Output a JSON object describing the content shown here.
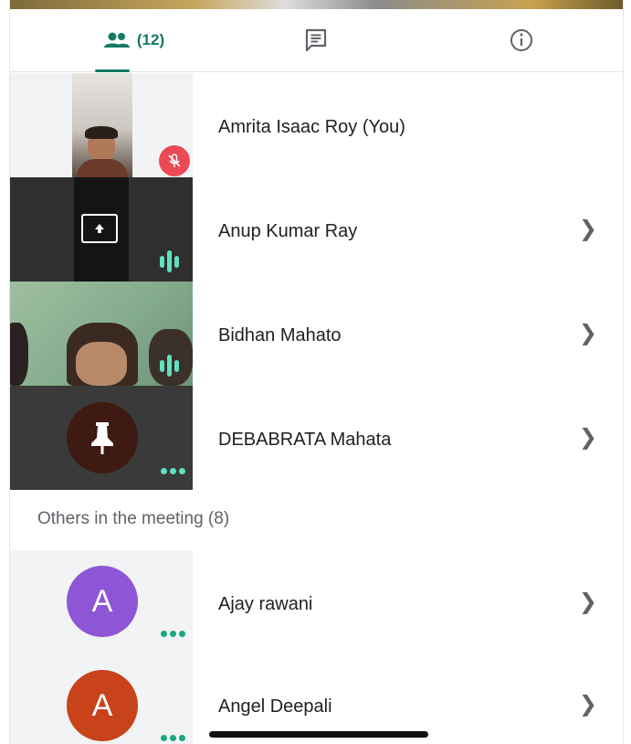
{
  "tabs": {
    "people_count": "(12)",
    "accent_color": "#137a65",
    "people_icon": "people-icon",
    "chat_icon": "chat-icon",
    "info_icon": "info-icon"
  },
  "participants": [
    {
      "name": "Amrita Isaac Roy (You)",
      "status": "mic-off"
    },
    {
      "name": "Anup Kumar Ray",
      "status": "speaking"
    },
    {
      "name": "Bidhan Mahato",
      "status": "speaking"
    },
    {
      "name": "DEBABRATA Mahata",
      "status": "more"
    }
  ],
  "others_section": {
    "title": "Others in the meeting (8)",
    "people": [
      {
        "name": "Ajay rawani",
        "initial": "A",
        "color": "#8e56d6"
      },
      {
        "name": "Angel Deepali",
        "initial": "A",
        "color": "#c8421a"
      }
    ]
  }
}
